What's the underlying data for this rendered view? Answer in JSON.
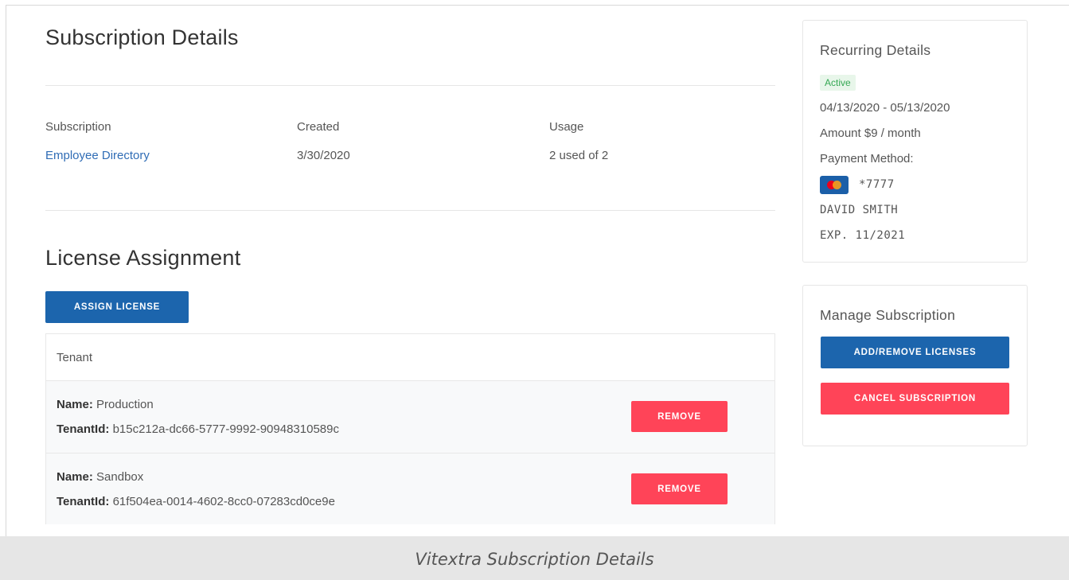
{
  "subscription_details": {
    "title": "Subscription Details",
    "columns": [
      {
        "label": "Subscription",
        "value": "Employee Directory"
      },
      {
        "label": "Created",
        "value": "3/30/2020"
      },
      {
        "label": "Usage",
        "value": "2 used of 2"
      }
    ]
  },
  "license_assignment": {
    "title": "License Assignment",
    "assign_button": "ASSIGN LICENSE",
    "table_header": "Tenant",
    "name_label": "Name:",
    "tenant_id_label": "TenantId:",
    "remove_label": "REMOVE",
    "rows": [
      {
        "name": "Production",
        "tenant_id": "b15c212a-dc66-5777-9992-90948310589c"
      },
      {
        "name": "Sandbox",
        "tenant_id": "61f504ea-0014-4602-8cc0-07283cd0ce9e"
      }
    ]
  },
  "recurring_details": {
    "title": "Recurring Details",
    "status": "Active",
    "period": "04/13/2020 - 05/13/2020",
    "amount": "Amount $9 / month",
    "payment_method_label": "Payment Method:",
    "card_icon": "mastercard-icon",
    "card_number": "*7777",
    "card_holder": "DAVID SMITH",
    "card_expiry": "EXP. 11/2021"
  },
  "manage_subscription": {
    "title": "Manage Subscription",
    "add_remove_button": "ADD/REMOVE LICENSES",
    "cancel_button": "CANCEL SUBSCRIPTION"
  },
  "caption": "Vitextra Subscription Details",
  "colors": {
    "primary": "#1c65ad",
    "danger": "#ff4458",
    "link": "#2f6cb5",
    "active": "#34a853"
  }
}
